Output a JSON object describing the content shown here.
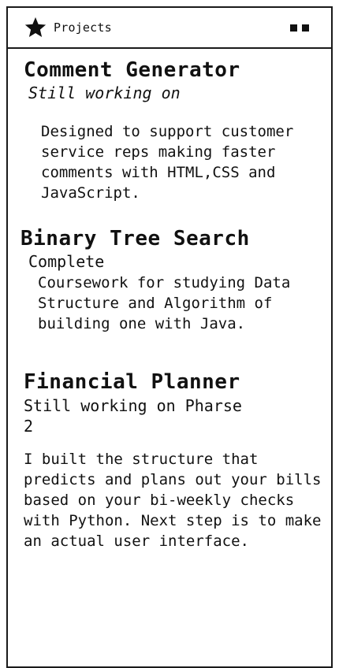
{
  "window": {
    "title": "Projects",
    "icon": "star-icon"
  },
  "projects": [
    {
      "title": "Comment Generator",
      "status": "Still working on",
      "description": "Designed to support customer service reps making faster comments with HTML,CSS and JavaScript."
    },
    {
      "title": "Binary Tree Search",
      "status": "Complete",
      "description": "Coursework for studying Data Structure and Algorithm of building one with Java."
    },
    {
      "title": "Financial Planner",
      "status": "Still working on Pharse 2",
      "description": "I built the structure that predicts and plans out your bills based on your bi-weekly checks with Python. Next step is to make an actual user interface."
    }
  ]
}
